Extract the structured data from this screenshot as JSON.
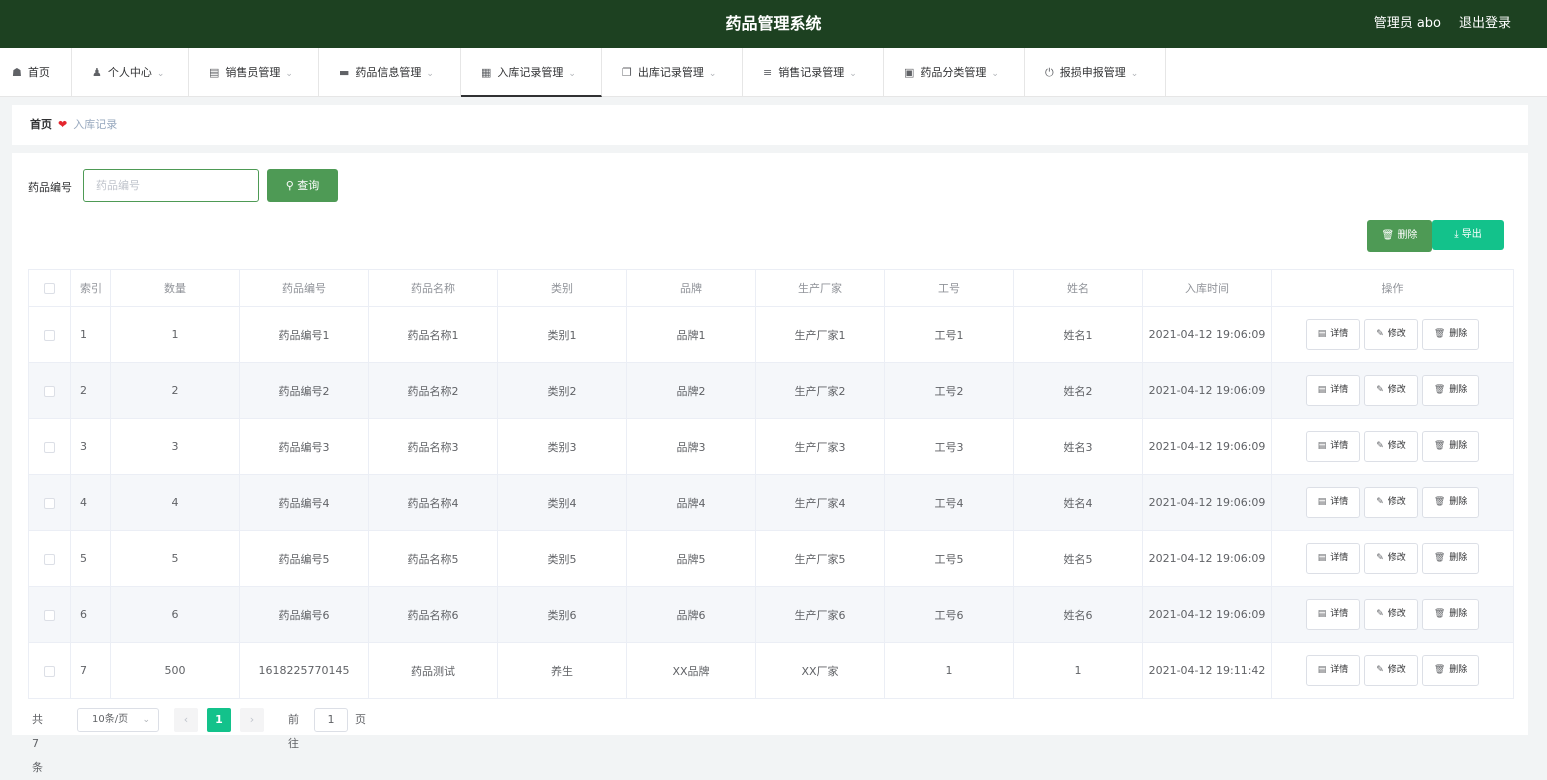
{
  "header": {
    "title": "药品管理系统",
    "user": "管理员 abo",
    "logout": "退出登录"
  },
  "nav": [
    {
      "label": "首页",
      "icon": "home-icon",
      "has_dropdown": false
    },
    {
      "label": "个人中心",
      "icon": "user-icon",
      "has_dropdown": true
    },
    {
      "label": "销售员管理",
      "icon": "clipboard-icon",
      "has_dropdown": true
    },
    {
      "label": "药品信息管理",
      "icon": "drawer-icon",
      "has_dropdown": true
    },
    {
      "label": "入库记录管理",
      "icon": "grid-icon",
      "has_dropdown": true,
      "active": true
    },
    {
      "label": "出库记录管理",
      "icon": "copy-icon",
      "has_dropdown": true
    },
    {
      "label": "销售记录管理",
      "icon": "list-icon",
      "has_dropdown": true
    },
    {
      "label": "药品分类管理",
      "icon": "chart-icon",
      "has_dropdown": true
    },
    {
      "label": "报损申报管理",
      "icon": "power-icon",
      "has_dropdown": true
    }
  ],
  "breadcrumb": {
    "home": "首页",
    "current": "入库记录"
  },
  "search": {
    "label": "药品编号",
    "placeholder": "药品编号",
    "button": "查询"
  },
  "actions": {
    "delete": "删除",
    "export": "导出"
  },
  "table": {
    "columns": [
      "索引",
      "数量",
      "药品编号",
      "药品名称",
      "类别",
      "品牌",
      "生产厂家",
      "工号",
      "姓名",
      "入库时间",
      "操作"
    ],
    "rows": [
      [
        "1",
        "1",
        "药品编号1",
        "药品名称1",
        "类别1",
        "品牌1",
        "生产厂家1",
        "工号1",
        "姓名1",
        "2021-04-12 19:06:09"
      ],
      [
        "2",
        "2",
        "药品编号2",
        "药品名称2",
        "类别2",
        "品牌2",
        "生产厂家2",
        "工号2",
        "姓名2",
        "2021-04-12 19:06:09"
      ],
      [
        "3",
        "3",
        "药品编号3",
        "药品名称3",
        "类别3",
        "品牌3",
        "生产厂家3",
        "工号3",
        "姓名3",
        "2021-04-12 19:06:09"
      ],
      [
        "4",
        "4",
        "药品编号4",
        "药品名称4",
        "类别4",
        "品牌4",
        "生产厂家4",
        "工号4",
        "姓名4",
        "2021-04-12 19:06:09"
      ],
      [
        "5",
        "5",
        "药品编号5",
        "药品名称5",
        "类别5",
        "品牌5",
        "生产厂家5",
        "工号5",
        "姓名5",
        "2021-04-12 19:06:09"
      ],
      [
        "6",
        "6",
        "药品编号6",
        "药品名称6",
        "类别6",
        "品牌6",
        "生产厂家6",
        "工号6",
        "姓名6",
        "2021-04-12 19:06:09"
      ],
      [
        "7",
        "500",
        "1618225770145",
        "药品测试",
        "养生",
        "XX品牌",
        "XX厂家",
        "1",
        "1",
        "2021-04-12 19:11:42"
      ]
    ],
    "row_actions": [
      "详情",
      "修改",
      "删除"
    ]
  },
  "pagination": {
    "total": "共 7 条",
    "page_size": "10条/页",
    "current_page": "1",
    "goto_label": "前往",
    "goto_value": "1",
    "goto_unit": "页"
  },
  "colors": {
    "header_bg": "#1d4121",
    "primary_green": "#4e9a55",
    "accent_teal": "#13c28b",
    "heart_red": "#e4262e"
  }
}
